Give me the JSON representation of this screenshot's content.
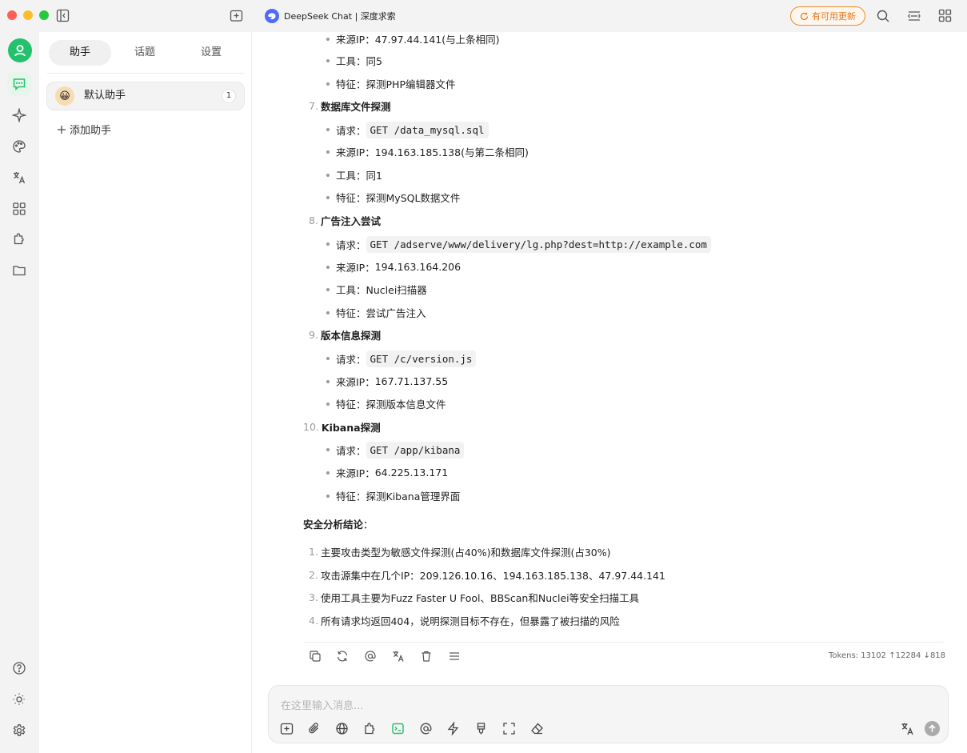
{
  "window": {
    "title": "DeepSeek Chat | 深度求索",
    "update_label": "有可用更新"
  },
  "sidebar": {
    "tabs": [
      "助手",
      "话题",
      "设置"
    ],
    "assistant": {
      "emoji": "😀",
      "name": "默认助手",
      "count": "1"
    },
    "add_label": "添加助手"
  },
  "message": {
    "item6_rest": [
      {
        "label": "来源IP：",
        "text": "47.97.44.141(与上条相同)"
      },
      {
        "label": "工具：",
        "text": "同5"
      },
      {
        "label": "特征：",
        "text": "探测PHP编辑器文件"
      }
    ],
    "items": [
      {
        "num": "7.",
        "title": "数据库文件探测",
        "request_label": "请求：",
        "request": "GET /data_mysql.sql",
        "details": [
          {
            "label": "来源IP：",
            "text": "194.163.185.138(与第二条相同)"
          },
          {
            "label": "工具：",
            "text": "同1"
          },
          {
            "label": "特征：",
            "text": "探测MySQL数据文件"
          }
        ]
      },
      {
        "num": "8.",
        "title": "广告注入尝试",
        "request_label": "请求：",
        "request": "GET /adserve/www/delivery/lg.php?dest=http://example.com",
        "details": [
          {
            "label": "来源IP：",
            "text": "194.163.164.206"
          },
          {
            "label": "工具：",
            "text": "Nuclei扫描器"
          },
          {
            "label": "特征：",
            "text": "尝试广告注入"
          }
        ]
      },
      {
        "num": "9.",
        "title": "版本信息探测",
        "request_label": "请求：",
        "request": "GET /c/version.js",
        "details": [
          {
            "label": "来源IP：",
            "text": "167.71.137.55"
          },
          {
            "label": "特征：",
            "text": "探测版本信息文件"
          }
        ]
      },
      {
        "num": "10.",
        "title": "Kibana探测",
        "request_label": "请求：",
        "request": "GET /app/kibana",
        "details": [
          {
            "label": "来源IP：",
            "text": "64.225.13.171"
          },
          {
            "label": "特征：",
            "text": "探测Kibana管理界面"
          }
        ]
      }
    ],
    "conclusion_title": "安全分析结论",
    "conclusion_colon": "：",
    "conclusions": [
      {
        "num": "1.",
        "text": "主要攻击类型为敏感文件探测(占40%)和数据库文件探测(占30%)"
      },
      {
        "num": "2.",
        "text": "攻击源集中在几个IP：209.126.10.16、194.163.185.138、47.97.44.141"
      },
      {
        "num": "3.",
        "text": "使用工具主要为Fuzz Faster U Fool、BBScan和Nuclei等安全扫描工具"
      },
      {
        "num": "4.",
        "text": "所有请求均返回404，说明探测目标不存在，但暴露了被扫描的风险"
      }
    ],
    "tokens": "Tokens: 13102 ↑12284 ↓818"
  },
  "input": {
    "placeholder": "在这里输入消息..."
  },
  "colors": {
    "accent_green": "#23c16b",
    "update_orange": "#f08a24",
    "deepseek_blue": "#4d6bfe"
  }
}
